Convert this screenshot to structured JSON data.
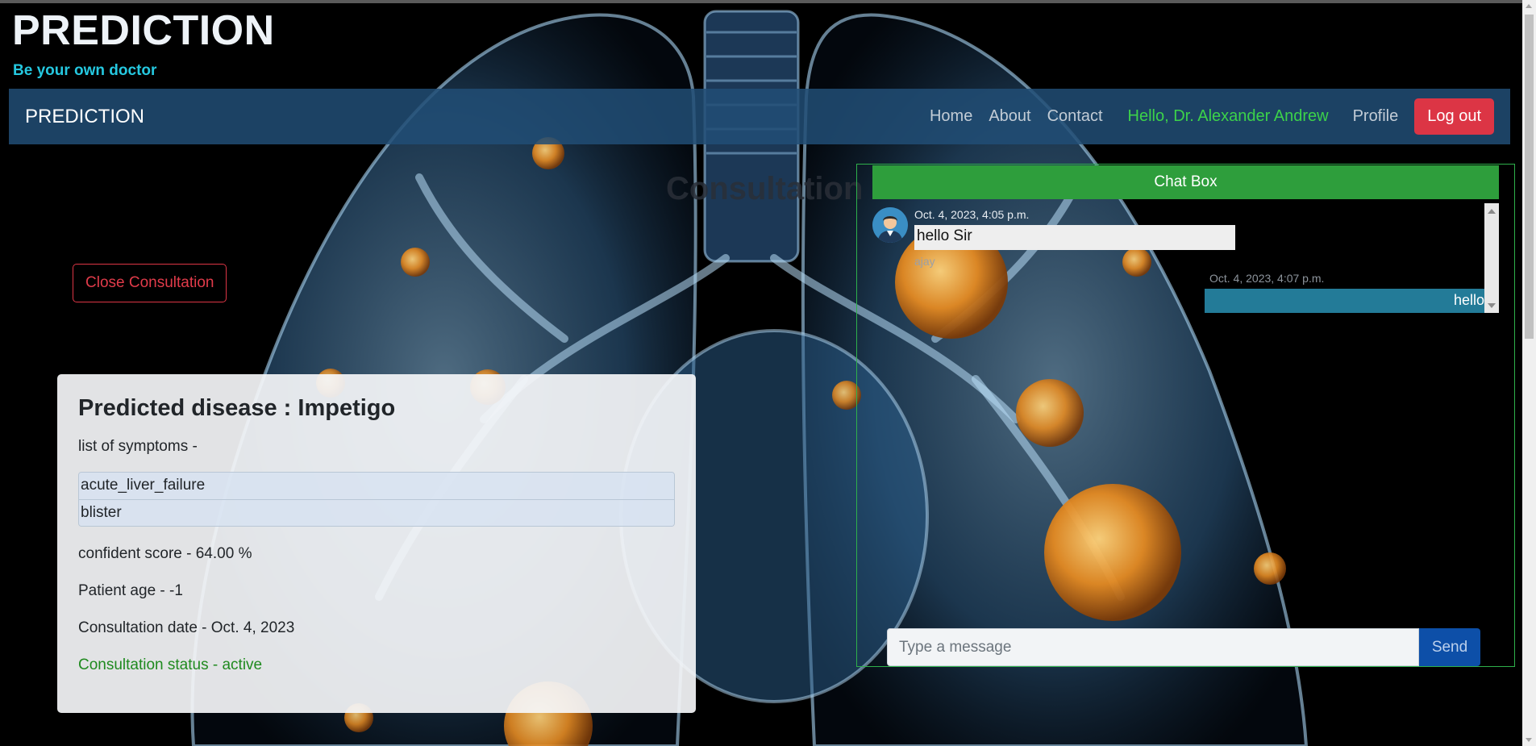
{
  "brand": {
    "title": "PREDICTION",
    "tagline": "Be your own doctor"
  },
  "navbar": {
    "brand": "PREDICTION",
    "links": [
      "Home",
      "About",
      "Contact"
    ],
    "greeting": "Hello, Dr. Alexander Andrew",
    "profile": "Profile",
    "logout": "Log out"
  },
  "page": {
    "heading": "Consultation",
    "close_button": "Close Consultation"
  },
  "prediction": {
    "title": "Predicted disease : Impetigo",
    "symptoms_label": "list of symptoms -",
    "symptoms": [
      "acute_liver_failure",
      "blister"
    ],
    "confidence": "confident score - 64.00 %",
    "patient_age": "Patient age - -1",
    "consultation_date": "Consultation date - Oct. 4, 2023",
    "status": "Consultation status - active"
  },
  "chat": {
    "header": "Chat Box",
    "messages": [
      {
        "time": "Oct. 4, 2023, 4:05 p.m.",
        "text": "hello Sir",
        "sender": "ajay",
        "side": "left",
        "avatar": "doctor-avatar-icon"
      },
      {
        "time": "Oct. 4, 2023, 4:07 p.m.",
        "text": "hello",
        "side": "right"
      }
    ],
    "input_placeholder": "Type a message",
    "send": "Send"
  },
  "colors": {
    "navbar": "#214e76",
    "logout": "#dc3545",
    "greeting": "#3cd24a",
    "tagline": "#25c8e0",
    "chat_header": "#2e9e3c",
    "sent_bubble": "#237b98",
    "send_button": "#0d4fa8",
    "status": "#1f8a1f"
  }
}
